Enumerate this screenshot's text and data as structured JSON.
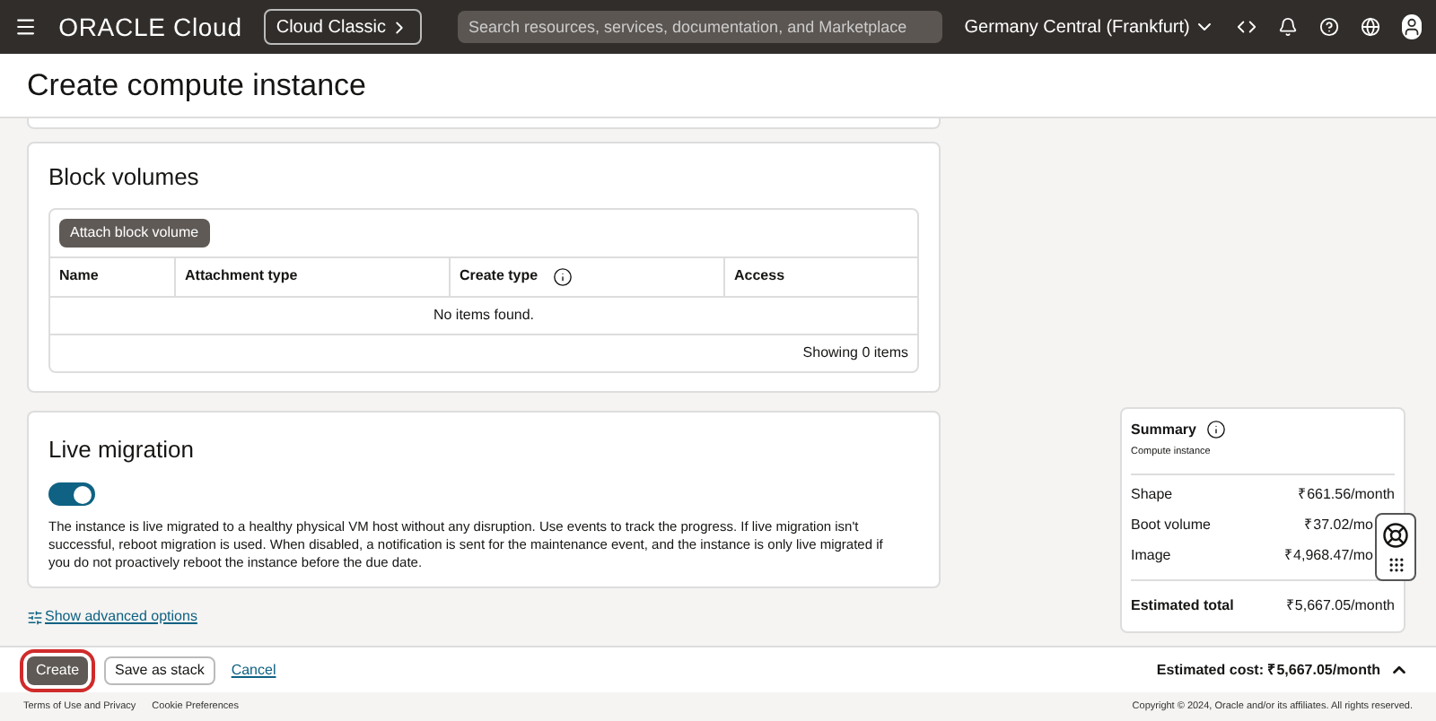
{
  "header": {
    "brand": "ORACLE Cloud",
    "classic_button": "Cloud Classic",
    "search": {
      "placeholder": "Search resources, services, documentation, and Marketplace"
    },
    "region": "Germany Central (Frankfurt)"
  },
  "page_title": "Create compute instance",
  "block_volumes": {
    "title": "Block volumes",
    "attach_button": "Attach block volume",
    "columns": [
      {
        "label": "Name",
        "info": false
      },
      {
        "label": "Attachment type",
        "info": false
      },
      {
        "label": "Create type",
        "info": true
      },
      {
        "label": "Access",
        "info": false
      }
    ],
    "empty_text": "No items found.",
    "footer": "Showing 0 items"
  },
  "live_migration": {
    "title": "Live migration",
    "on": true,
    "description": "The instance is live migrated to a healthy physical VM host without any disruption. Use events to track the progress. If live migration isn't successful, reboot migration is used. When disabled, a notification is sent for the maintenance event, and the instance is only live migrated if you do not proactively reboot the instance before the due date."
  },
  "advanced_link": "Show advanced options",
  "summary": {
    "title": "Summary",
    "subtitle": "Compute instance",
    "rows": [
      {
        "label": "Shape",
        "value": "₹661.56/month"
      },
      {
        "label": "Boot volume",
        "value": "₹37.02/mo"
      },
      {
        "label": "Image",
        "value": "₹4,968.47/mo"
      }
    ],
    "total_label": "Estimated total",
    "total_value": "₹5,667.05/month"
  },
  "actions": {
    "create": "Create",
    "save_stack": "Save as stack",
    "cancel": "Cancel",
    "estimated_cost": "Estimated cost: ₹5,667.05/month"
  },
  "footer": {
    "links": [
      "Terms of Use and Privacy",
      "Cookie Preferences"
    ],
    "copyright": "Copyright © 2024, Oracle and/or its affiliates. All rights reserved."
  }
}
